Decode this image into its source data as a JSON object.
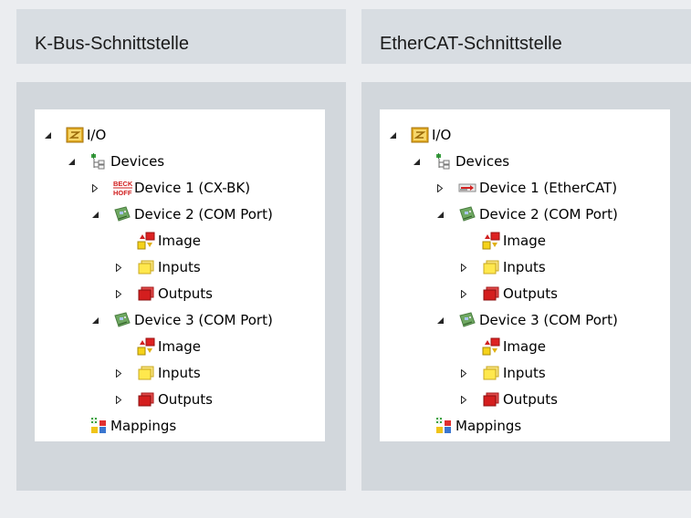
{
  "columns": [
    {
      "title": "K-Bus-Schnittstelle",
      "tree": [
        {
          "label": "I/O",
          "icon": "io-folder-icon",
          "expander": "expanded"
        },
        {
          "label": "Devices",
          "icon": "devices-tree-icon",
          "expander": "expanded"
        },
        {
          "label": "Device 1 (CX-BK)",
          "icon": "beckhoff-logo-icon",
          "expander": "collapsed"
        },
        {
          "label": "Device 2 (COM Port)",
          "icon": "com-port-card-icon",
          "expander": "expanded"
        },
        {
          "label": "Image",
          "icon": "image-icon",
          "expander": "none"
        },
        {
          "label": "Inputs",
          "icon": "inputs-icon",
          "expander": "collapsed"
        },
        {
          "label": "Outputs",
          "icon": "outputs-icon",
          "expander": "collapsed"
        },
        {
          "label": "Device 3 (COM Port)",
          "icon": "com-port-card-icon",
          "expander": "expanded"
        },
        {
          "label": "Image",
          "icon": "image-icon",
          "expander": "none"
        },
        {
          "label": "Inputs",
          "icon": "inputs-icon",
          "expander": "collapsed"
        },
        {
          "label": "Outputs",
          "icon": "outputs-icon",
          "expander": "collapsed"
        },
        {
          "label": "Mappings",
          "icon": "mappings-icon",
          "expander": "none"
        }
      ]
    },
    {
      "title": "EtherCAT-Schnittstelle",
      "tree": [
        {
          "label": "I/O",
          "icon": "io-folder-icon",
          "expander": "expanded"
        },
        {
          "label": "Devices",
          "icon": "devices-tree-icon",
          "expander": "expanded"
        },
        {
          "label": "Device 1 (EtherCAT)",
          "icon": "ethercat-icon",
          "expander": "collapsed"
        },
        {
          "label": "Device 2 (COM Port)",
          "icon": "com-port-card-icon",
          "expander": "expanded"
        },
        {
          "label": "Image",
          "icon": "image-icon",
          "expander": "none"
        },
        {
          "label": "Inputs",
          "icon": "inputs-icon",
          "expander": "collapsed"
        },
        {
          "label": "Outputs",
          "icon": "outputs-icon",
          "expander": "collapsed"
        },
        {
          "label": "Device 3 (COM Port)",
          "icon": "com-port-card-icon",
          "expander": "expanded"
        },
        {
          "label": "Image",
          "icon": "image-icon",
          "expander": "none"
        },
        {
          "label": "Inputs",
          "icon": "inputs-icon",
          "expander": "collapsed"
        },
        {
          "label": "Outputs",
          "icon": "outputs-icon",
          "expander": "collapsed"
        },
        {
          "label": "Mappings",
          "icon": "mappings-icon",
          "expander": "none"
        }
      ]
    }
  ],
  "beckhoff_logo_text": [
    "BECK",
    "HOFF"
  ]
}
